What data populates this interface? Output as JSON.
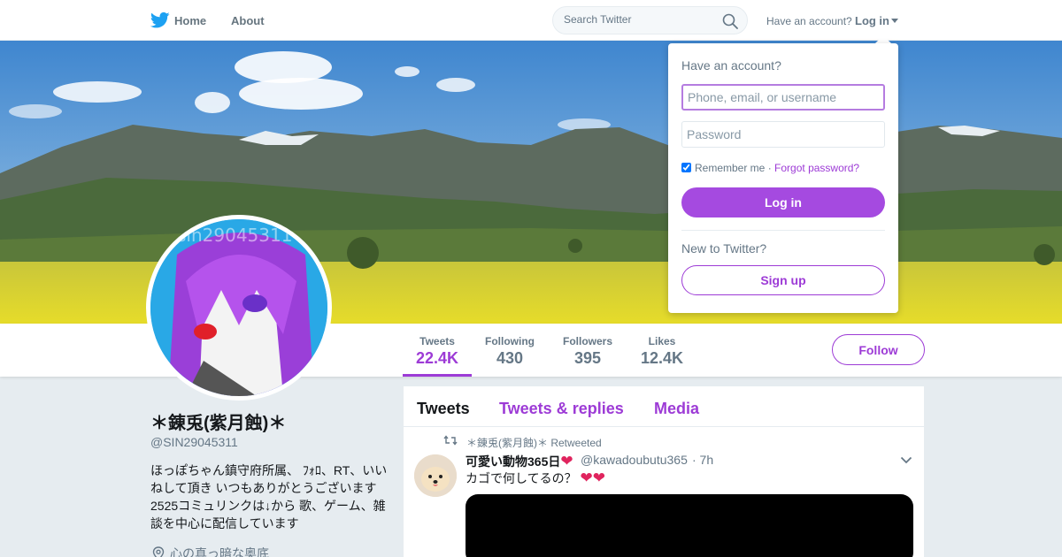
{
  "nav": {
    "home_label": "Home",
    "about_label": "About",
    "search_placeholder": "Search Twitter",
    "have_account_label": "Have an account?",
    "login_label": "Log in"
  },
  "profile": {
    "name": "＊錬兎(紫月蝕)＊",
    "handle": "@SIN29045311",
    "bio": "ほっぽちゃん鎮守府所属、 ﾌｫﾛ、RT、いいねして頂き いつもありがとうございます 2525コミュリンクは↓から 歌、ゲーム、雑談を中心に配信しています",
    "location": "心の真っ暗な奥底",
    "avatar_text": "sin29045311"
  },
  "stats": [
    {
      "label": "Tweets",
      "value": "22.4K"
    },
    {
      "label": "Following",
      "value": "430"
    },
    {
      "label": "Followers",
      "value": "395"
    },
    {
      "label": "Likes",
      "value": "12.4K"
    }
  ],
  "follow_label": "Follow",
  "timeline": {
    "tabs": [
      "Tweets",
      "Tweets & replies",
      "Media"
    ],
    "tweet": {
      "retweeted_by": "＊錬兎(紫月蝕)＊ Retweeted",
      "author_name": "可愛い動物365日",
      "author_handle": "@kawadoubutu365",
      "time": "· 7h",
      "text": "カゴで何してるの？"
    }
  },
  "login_dropdown": {
    "title": "Have an account?",
    "username_placeholder": "Phone, email, or username",
    "password_placeholder": "Password",
    "remember_label": "Remember me",
    "separator": "·",
    "forgot_label": "Forgot password?",
    "login_button": "Log in",
    "new_label": "New to Twitter?",
    "signup_button": "Sign up"
  },
  "colors": {
    "accent": "#9d3bd6",
    "twitter_blue": "#1da1f2",
    "heart": "#e0245e"
  }
}
